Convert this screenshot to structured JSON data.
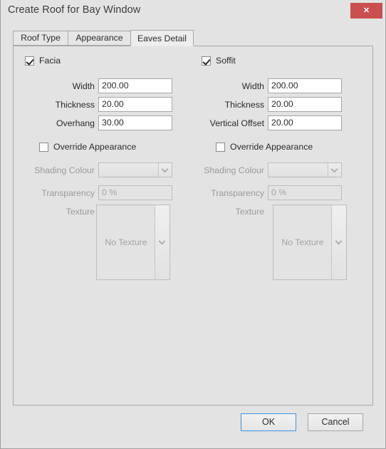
{
  "window": {
    "title": "Create Roof for Bay Window",
    "close_label": "✕"
  },
  "tabs": [
    {
      "label": "Roof Type",
      "active": false
    },
    {
      "label": "Appearance",
      "active": false
    },
    {
      "label": "Eaves Detail",
      "active": true
    }
  ],
  "panels": {
    "facia": {
      "enabled_label": "Facia",
      "enabled_checked": true,
      "fields": [
        {
          "label": "Width",
          "value": "200.00"
        },
        {
          "label": "Thickness",
          "value": "20.00"
        },
        {
          "label": "Overhang",
          "value": "30.00"
        }
      ],
      "override_label": "Override Appearance",
      "override_checked": false,
      "shading_colour_label": "Shading Colour",
      "shading_colour_value": "",
      "transparency_label": "Transparency",
      "transparency_value": "0 %",
      "texture_label": "Texture",
      "texture_value": "No Texture"
    },
    "soffit": {
      "enabled_label": "Soffit",
      "enabled_checked": true,
      "fields": [
        {
          "label": "Width",
          "value": "200.00"
        },
        {
          "label": "Thickness",
          "value": "20.00"
        },
        {
          "label": "Vertical Offset",
          "value": "20.00"
        }
      ],
      "override_label": "Override Appearance",
      "override_checked": false,
      "shading_colour_label": "Shading Colour",
      "shading_colour_value": "",
      "transparency_label": "Transparency",
      "transparency_value": "0 %",
      "texture_label": "Texture",
      "texture_value": "No Texture"
    }
  },
  "footer": {
    "ok_label": "OK",
    "cancel_label": "Cancel"
  },
  "colors": {
    "dialog_background": "#e3e3e3",
    "close_button": "#c9504f",
    "focus_border": "#3c93e0",
    "text": "#2b2b2b",
    "disabled_text": "#a3a3a3"
  }
}
